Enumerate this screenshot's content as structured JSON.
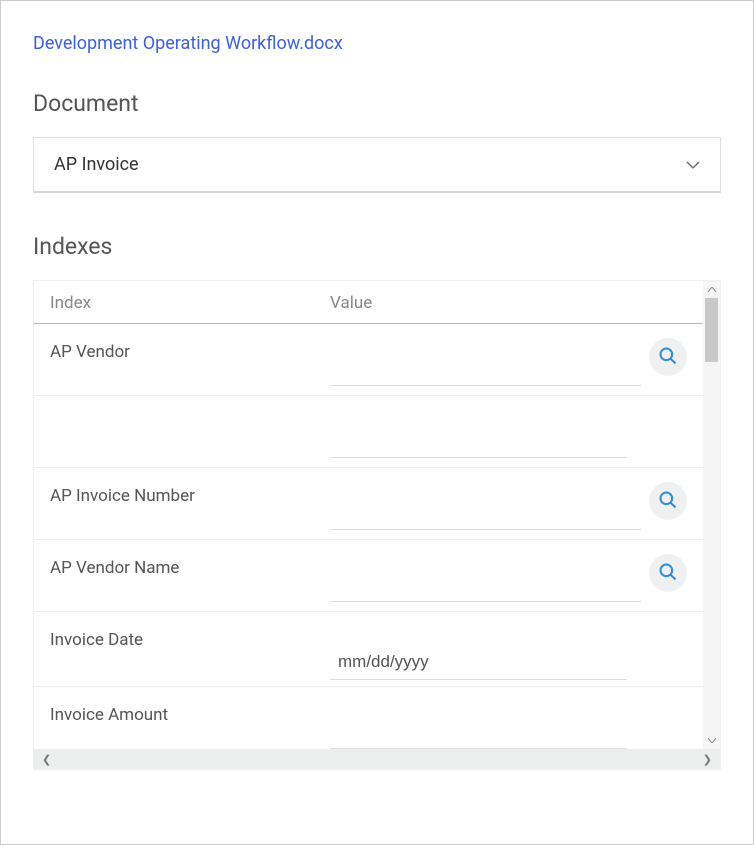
{
  "file_name": "Development Operating Workflow.docx",
  "document_section_title": "Document",
  "document_type_selected": "AP Invoice",
  "indexes_section_title": "Indexes",
  "table": {
    "header_index": "Index",
    "header_value": "Value"
  },
  "rows": [
    {
      "label": "AP Vendor",
      "value": "",
      "has_lookup": true,
      "type": "text"
    },
    {
      "label": "",
      "value": "",
      "has_lookup": false,
      "type": "text"
    },
    {
      "label": "AP Invoice Number",
      "value": "",
      "has_lookup": true,
      "type": "text"
    },
    {
      "label": "AP Vendor Name",
      "value": "",
      "has_lookup": true,
      "type": "text"
    },
    {
      "label": "Invoice Date",
      "value": "",
      "placeholder": "mm/dd/yyyy",
      "has_lookup": false,
      "type": "date"
    },
    {
      "label": "Invoice Amount",
      "value": "",
      "has_lookup": false,
      "type": "text"
    }
  ]
}
